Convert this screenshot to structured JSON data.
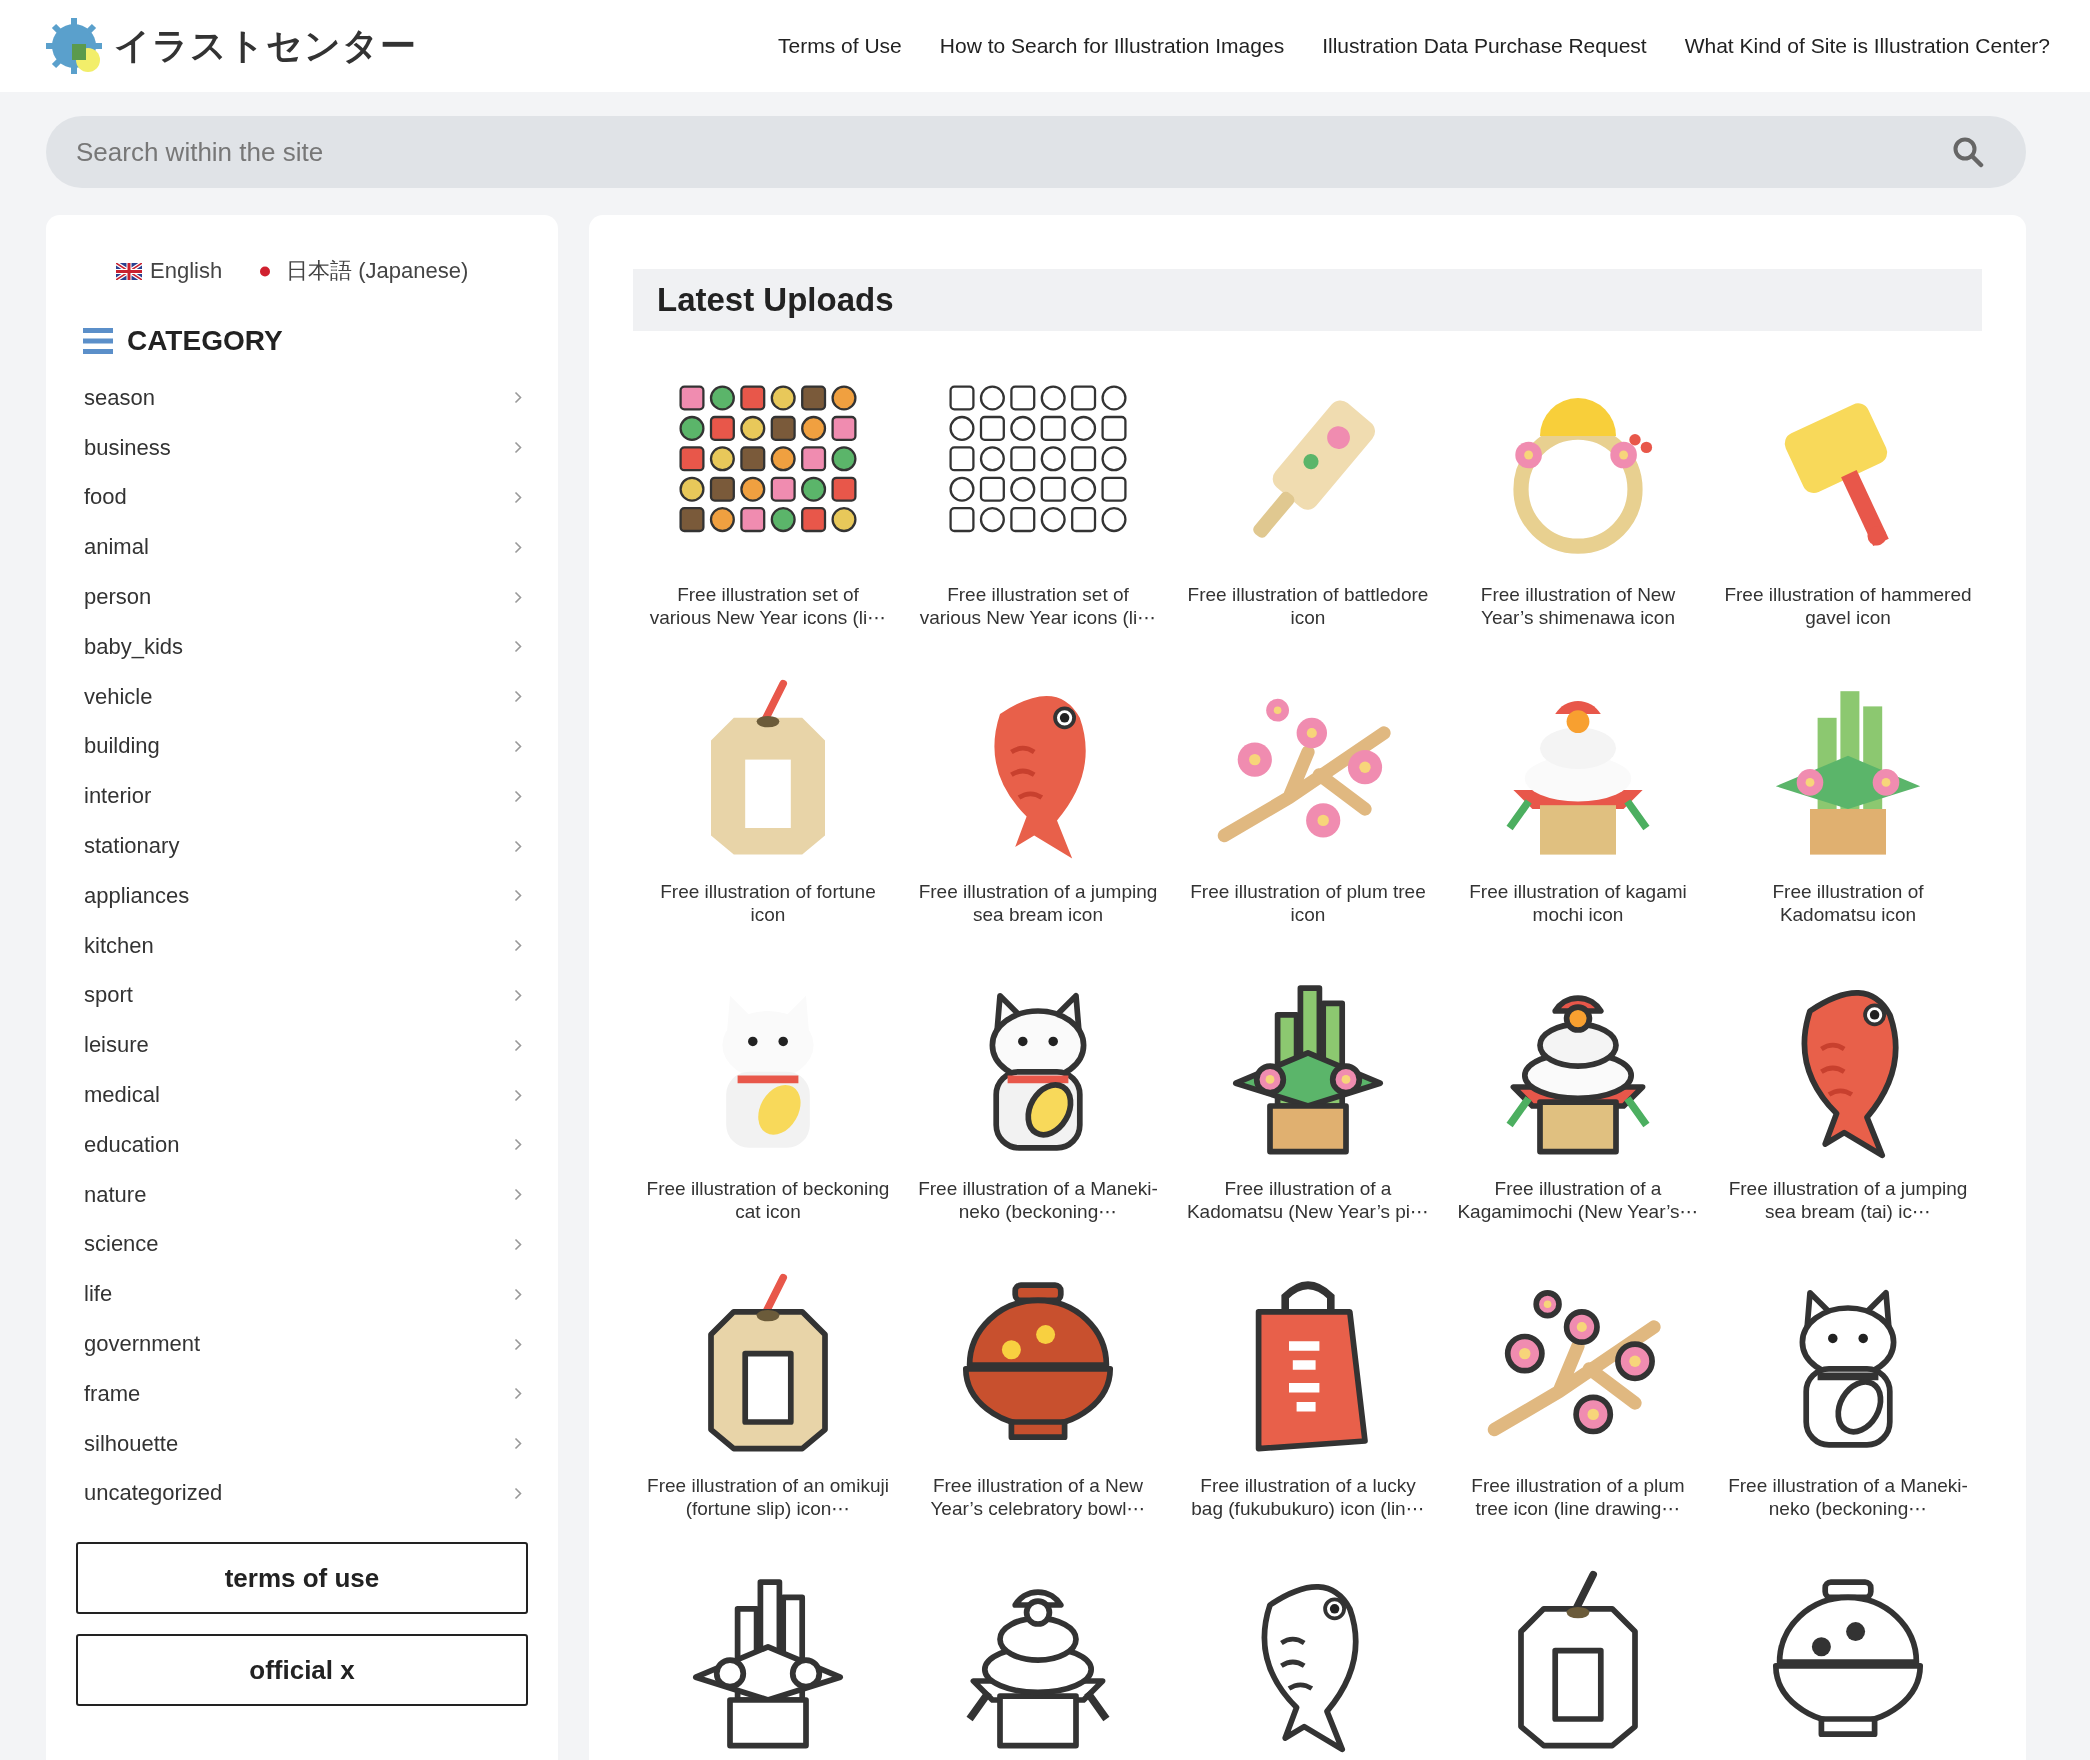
{
  "header": {
    "logo": "イラストセンター",
    "nav": [
      "Terms of Use",
      "How to Search for Illustration Images",
      "Illustration Data Purchase Request",
      "What Kind of Site is Illustration Center?"
    ]
  },
  "search": {
    "placeholder": "Search within the site"
  },
  "sidebar": {
    "languages": [
      {
        "label": "English",
        "kind": "uk"
      },
      {
        "label": "日本語 (Japanese)",
        "kind": "jp"
      }
    ],
    "category_title": "CATEGORY",
    "categories": [
      "season",
      "business",
      "food",
      "animal",
      "person",
      "baby_kids",
      "vehicle",
      "building",
      "interior",
      "stationary",
      "appliances",
      "kitchen",
      "sport",
      "leisure",
      "medical",
      "education",
      "nature",
      "science",
      "life",
      "government",
      "frame",
      "silhouette",
      "uncategorized"
    ],
    "buttons": [
      "terms of use",
      "official x"
    ]
  },
  "uploads": {
    "title": "Latest Uploads",
    "items": [
      {
        "caption": "Free illustration set of various New Year icons (li⋯",
        "kind": "icon-set"
      },
      {
        "caption": "Free illustration set of various New Year icons (li⋯",
        "kind": "icon-set"
      },
      {
        "caption": "Free illustration of battledore icon",
        "kind": "battledore"
      },
      {
        "caption": "Free illustration of New Year’s shimenawa icon",
        "kind": "shimenawa"
      },
      {
        "caption": "Free illustration of hammered gavel icon",
        "kind": "gavel"
      },
      {
        "caption": "Free illustration of fortune icon",
        "kind": "omikuji"
      },
      {
        "caption": "Free illustration of a jumping sea bream icon",
        "kind": "sea-bream"
      },
      {
        "caption": "Free illustration of plum tree icon",
        "kind": "plum"
      },
      {
        "caption": "Free illustration of kagami mochi icon",
        "kind": "kagami-mochi"
      },
      {
        "caption": "Free illustration of Kadomatsu icon",
        "kind": "kadomatsu"
      },
      {
        "caption": "Free illustration of beckoning cat icon",
        "kind": "cat"
      },
      {
        "caption": "Free illustration of a Maneki-neko (beckoning⋯",
        "kind": "cat"
      },
      {
        "caption": "Free illustration of a Kadomatsu (New Year’s pi⋯",
        "kind": "kadomatsu"
      },
      {
        "caption": "Free illustration of a Kagamimochi (New Year’s⋯",
        "kind": "kagami-mochi"
      },
      {
        "caption": "Free illustration of a jumping sea bream (tai) ic⋯",
        "kind": "sea-bream"
      },
      {
        "caption": "Free illustration of an omikuji (fortune slip) icon⋯",
        "kind": "omikuji"
      },
      {
        "caption": "Free illustration of a New Year’s celebratory bowl⋯",
        "kind": "bowl"
      },
      {
        "caption": "Free illustration of a lucky bag (fukubukuro) icon (lin⋯",
        "kind": "bag"
      },
      {
        "caption": "Free illustration of a plum tree icon (line drawing⋯",
        "kind": "plum"
      },
      {
        "caption": "Free illustration of a Maneki-neko (beckoning⋯",
        "kind": "cat"
      },
      {
        "kind": "kadomatsu"
      },
      {
        "kind": "kagami-mochi"
      },
      {
        "kind": "sea-bream"
      },
      {
        "kind": "omikuji"
      },
      {
        "kind": "bowl"
      }
    ]
  }
}
